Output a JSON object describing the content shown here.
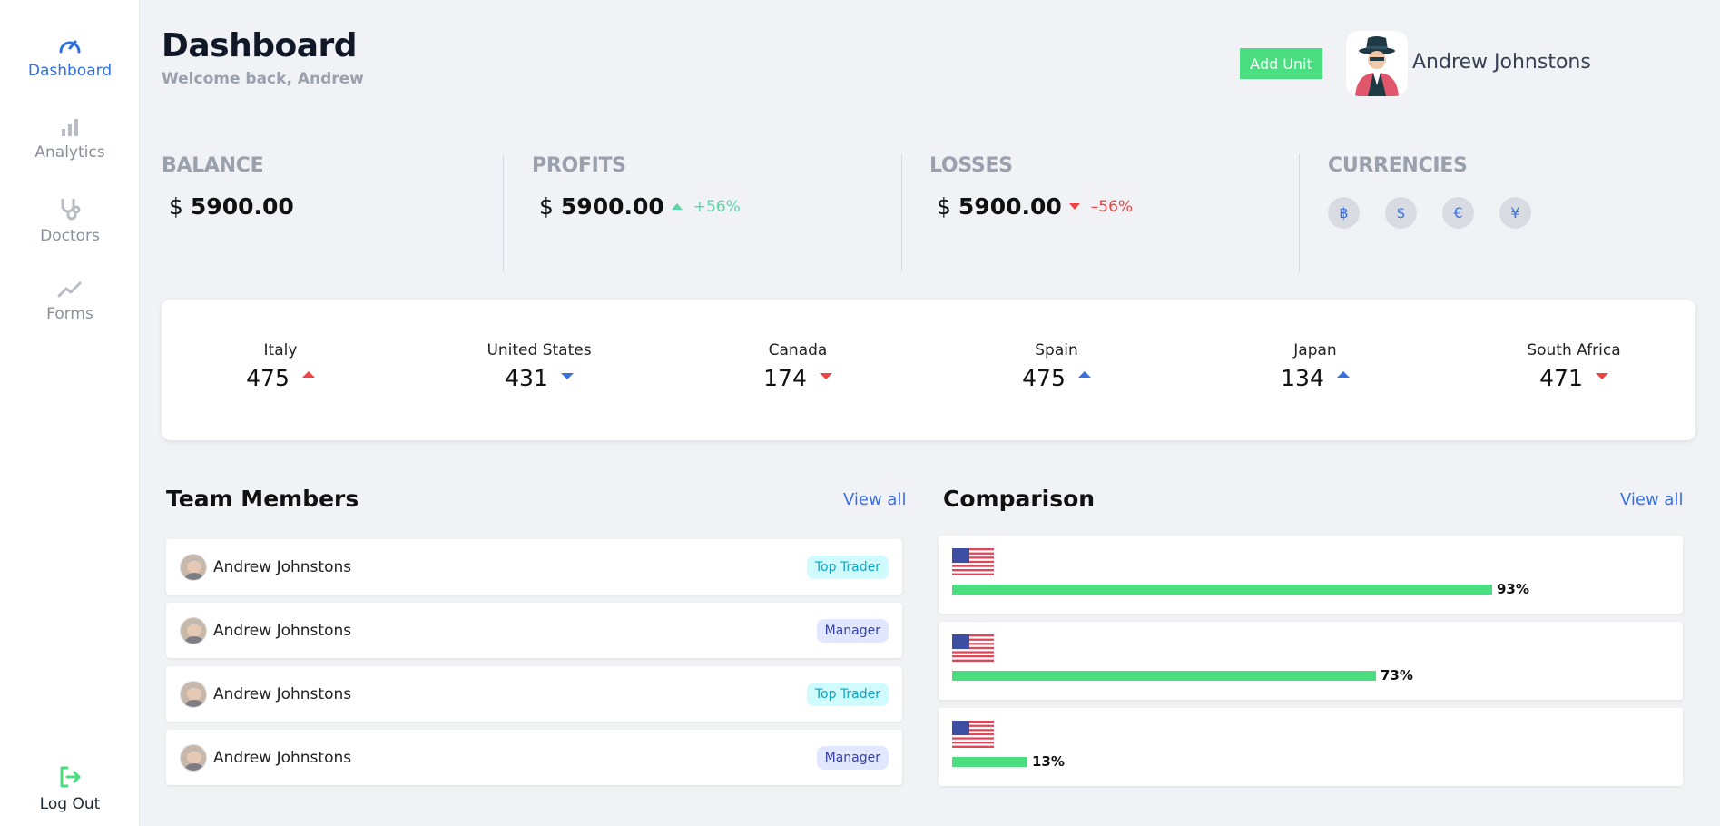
{
  "sidebar": {
    "items": [
      {
        "label": "Dashboard",
        "icon": "speedometer-icon",
        "active": true
      },
      {
        "label": "Analytics",
        "icon": "bar-chart-icon",
        "active": false
      },
      {
        "label": "Doctors",
        "icon": "stethoscope-icon",
        "active": false
      },
      {
        "label": "Forms",
        "icon": "trend-line-icon",
        "active": false
      }
    ],
    "logout": {
      "label": "Log Out",
      "icon": "logout-icon"
    }
  },
  "header": {
    "title": "Dashboard",
    "subtitle": "Welcome back, Andrew",
    "add_unit_label": "Add Unit",
    "user_name": "Andrew Johnstons"
  },
  "stats": {
    "balance": {
      "label": "BALANCE",
      "currency": "$",
      "value": "5900.00"
    },
    "profits": {
      "label": "PROFITS",
      "currency": "$",
      "value": "5900.00",
      "delta": "+56%"
    },
    "losses": {
      "label": "LOSSES",
      "currency": "$",
      "value": "5900.00",
      "delta": "–56%"
    },
    "currencies": {
      "label": "CURRENCIES",
      "symbols": [
        "฿",
        "$",
        "€",
        "¥"
      ]
    }
  },
  "countries": [
    {
      "name": "Italy",
      "value": "475",
      "trend": "up",
      "color": "#ef4444"
    },
    {
      "name": "United States",
      "value": "431",
      "trend": "down",
      "color": "#3b6fe0"
    },
    {
      "name": "Canada",
      "value": "174",
      "trend": "down",
      "color": "#ef4444"
    },
    {
      "name": "Spain",
      "value": "475",
      "trend": "up",
      "color": "#3b6fe0"
    },
    {
      "name": "Japan",
      "value": "134",
      "trend": "up",
      "color": "#3b6fe0"
    },
    {
      "name": "South Africa",
      "value": "471",
      "trend": "down",
      "color": "#ef4444"
    }
  ],
  "team": {
    "title": "Team Members",
    "view_all": "View all",
    "members": [
      {
        "name": "Andrew Johnstons",
        "role": "Top Trader"
      },
      {
        "name": "Andrew Johnstons",
        "role": "Manager"
      },
      {
        "name": "Andrew Johnstons",
        "role": "Top Trader"
      },
      {
        "name": "Andrew Johnstons",
        "role": "Manager"
      }
    ]
  },
  "comparison": {
    "title": "Comparison",
    "view_all": "View all",
    "rows": [
      {
        "flag": "us-flag-icon",
        "percent": 93,
        "label": "93%"
      },
      {
        "flag": "us-flag-icon",
        "percent": 73,
        "label": "73%"
      },
      {
        "flag": "us-flag-icon",
        "percent": 13,
        "label": "13%"
      }
    ]
  },
  "colors": {
    "accent": "#2f6fe0",
    "success": "#4ade80",
    "up": "#5cd6a8",
    "down": "#ef4444"
  }
}
